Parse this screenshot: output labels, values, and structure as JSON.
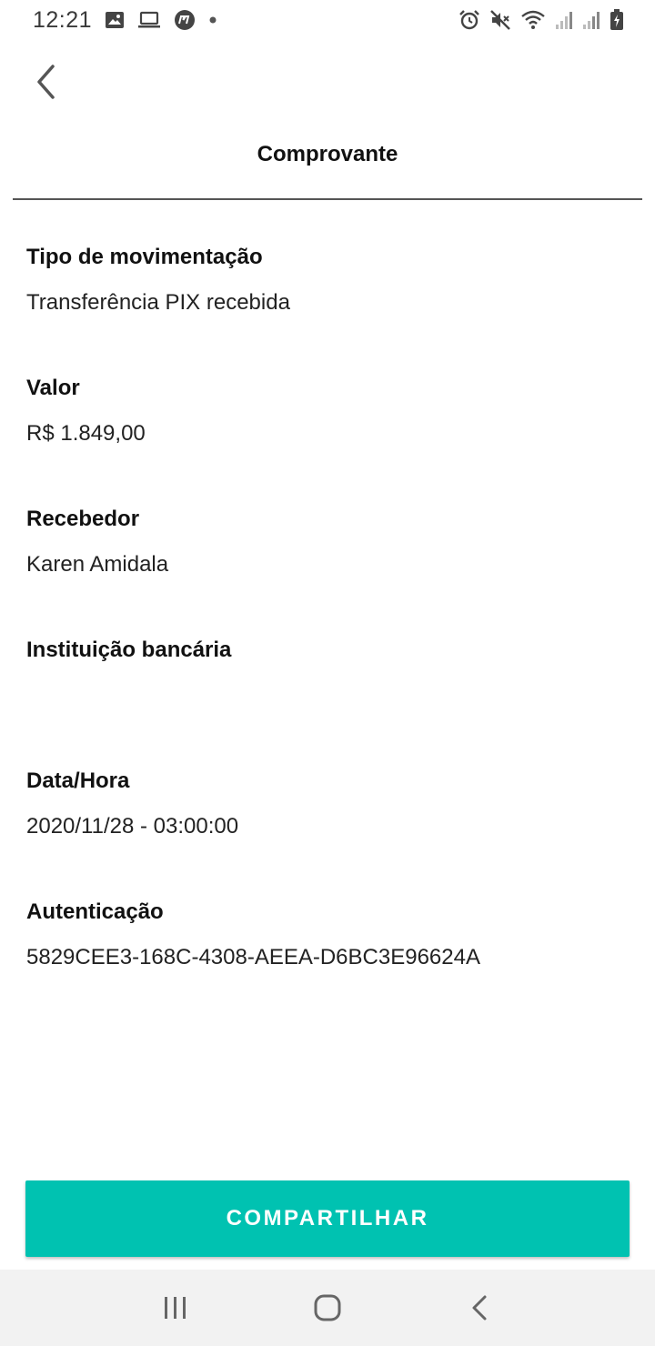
{
  "status_bar": {
    "time": "12:21",
    "left_icons": [
      "image-icon",
      "laptop-icon",
      "app-m-icon",
      "dot-icon"
    ],
    "right_icons": [
      "alarm-icon",
      "mute-icon",
      "wifi-icon",
      "signal-icon",
      "signal-icon",
      "battery-icon"
    ]
  },
  "header": {
    "back_icon": "chevron-left-icon",
    "title": "Comprovante"
  },
  "details": [
    {
      "label": "Tipo de movimentação",
      "value": "Transferência PIX recebida"
    },
    {
      "label": "Valor",
      "value": "R$ 1.849,00"
    },
    {
      "label": "Recebedor",
      "value": "Karen Amidala"
    },
    {
      "label": "Instituição bancária",
      "value": ""
    },
    {
      "label": "Data/Hora",
      "value": "2020/11/28 - 03:00:00"
    },
    {
      "label": "Autenticação",
      "value": "5829CEE3-168C-4308-AEEA-D6BC3E96624A"
    }
  ],
  "actions": {
    "share_label": "COMPARTILHAR"
  },
  "colors": {
    "accent": "#00c2b1",
    "nav_bar_bg": "#f2f2f2"
  },
  "nav_bar": {
    "icons": [
      "recent-apps-icon",
      "home-icon",
      "back-icon"
    ]
  }
}
